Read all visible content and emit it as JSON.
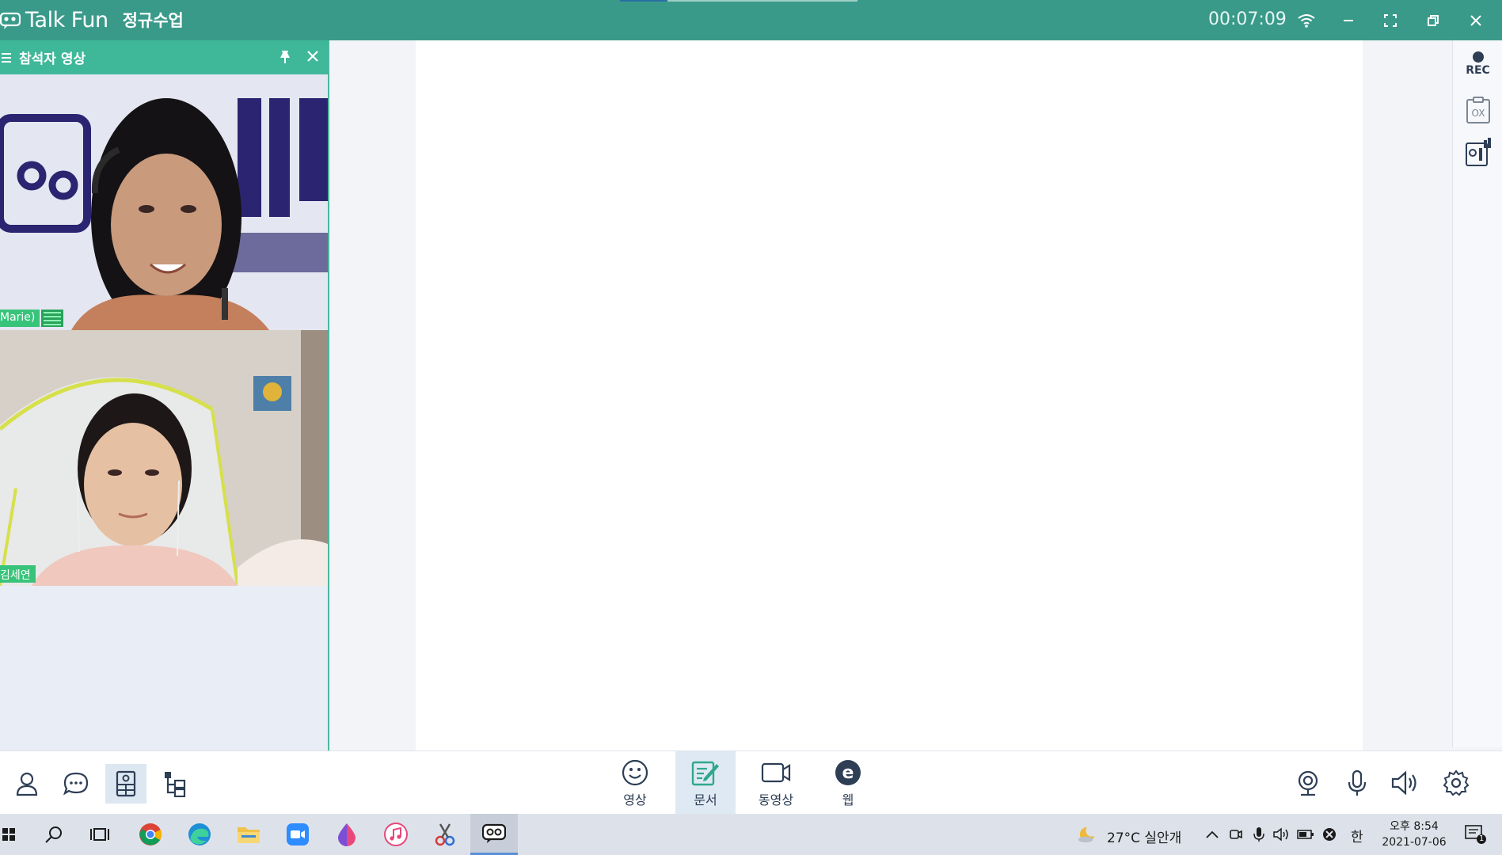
{
  "app": {
    "brand": "Talk Fun",
    "class_title": "정규수업",
    "timer": "00:07:09"
  },
  "panel": {
    "title": "참석자 영상",
    "participants": [
      {
        "name": "Marie)"
      },
      {
        "name": "김세연"
      }
    ]
  },
  "right_toolbar": {
    "rec_label": "REC",
    "items": [
      "record-icon",
      "ox-quiz-icon",
      "poll-chart-icon"
    ]
  },
  "bottom_toolbar": {
    "left_items": [
      "user-icon",
      "chat-icon",
      "layout-icon",
      "tree-icon"
    ],
    "center_items": [
      {
        "label": "영상",
        "icon": "smile-icon",
        "active": false
      },
      {
        "label": "문서",
        "icon": "document-icon",
        "active": true
      },
      {
        "label": "동영상",
        "icon": "video-camera-icon",
        "active": false
      },
      {
        "label": "웹",
        "icon": "web-icon",
        "active": false
      }
    ],
    "right_items": [
      "webcam-icon",
      "microphone-icon",
      "speaker-icon",
      "settings-icon"
    ]
  },
  "taskbar": {
    "weather": "27°C 실안개",
    "ime": "한",
    "time": "오후 8:54",
    "date": "2021-07-06",
    "notification_count": "1"
  },
  "colors": {
    "titlebar": "#3a9a8a",
    "panel_header": "#3fb89a",
    "name_tag": "#37c47a",
    "icon_dark": "#2d3e55"
  }
}
